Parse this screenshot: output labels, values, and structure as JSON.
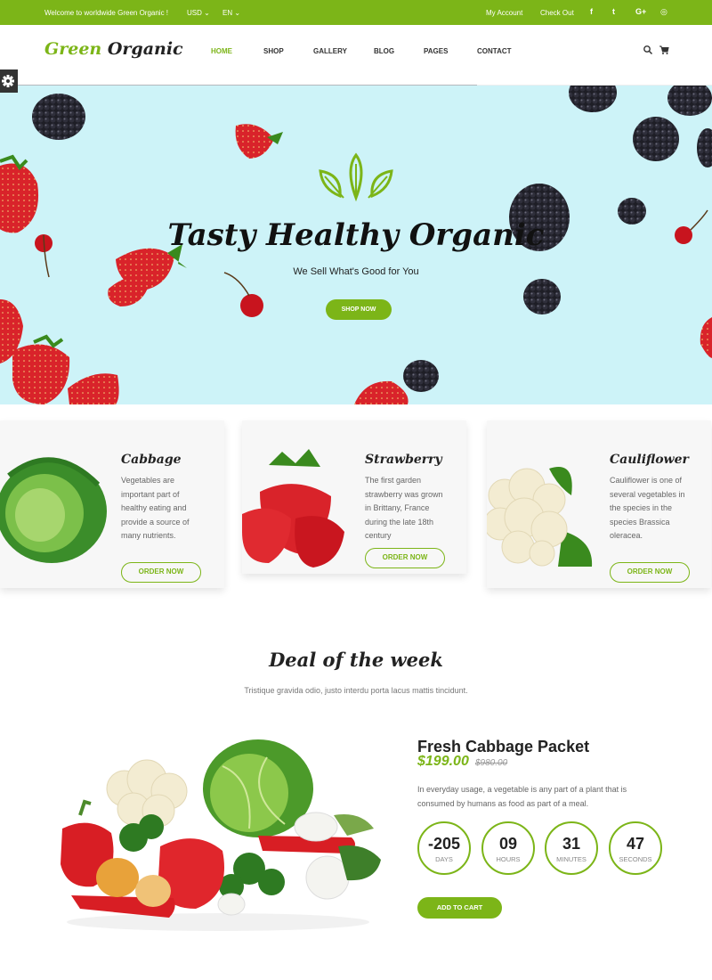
{
  "topbar": {
    "welcome": "Welcome to worldwide Green Organic !",
    "currency": "USD ⌄",
    "language": "EN ⌄",
    "my_account": "My Account",
    "check_out": "Check Out",
    "social": [
      {
        "icon": "facebook-icon",
        "glyph": "f"
      },
      {
        "icon": "twitter-icon",
        "glyph": "t"
      },
      {
        "icon": "google-plus-icon",
        "glyph": "G+"
      },
      {
        "icon": "instagram-icon",
        "glyph": "◎"
      }
    ]
  },
  "header": {
    "logo_green": "Green",
    "logo_dark": "Organic",
    "nav": [
      "HOME",
      "SHOP",
      "GALLERY",
      "BLOG",
      "PAGES",
      "CONTACT"
    ],
    "active_nav": "HOME",
    "icons": [
      "search-icon",
      "cart-icon"
    ],
    "page_load_progress": 0.67
  },
  "hero": {
    "title": "Tasty Healthy Organic",
    "subtitle": "We Sell What's Good for You",
    "button": "SHOP NOW"
  },
  "cards": [
    {
      "title": "Cabbage",
      "desc": "Vegetables are important part of healthy eating and provide a source of many nutrients.",
      "button": "ORDER NOW"
    },
    {
      "title": "Strawberry",
      "desc": "The first garden strawberry was grown in Brittany, France during the late 18th century",
      "button": "ORDER NOW"
    },
    {
      "title": "Cauliflower",
      "desc": "Cauliflower is one of several vegetables in the species in the species Brassica oleracea.",
      "button": "ORDER NOW"
    }
  ],
  "deal": {
    "title": "Deal of the week",
    "subtitle": "Tristique gravida odio, justo interdu porta lacus mattis tincidunt.",
    "product_name": "Fresh Cabbage Packet",
    "price": "$199.00",
    "old_price": "$980.00",
    "description": "In everyday usage, a vegetable is any part of a plant that is consumed by humans as food as part of a meal.",
    "countdown": [
      {
        "value": "-205",
        "label": "DAYS"
      },
      {
        "value": "09",
        "label": "HOURS"
      },
      {
        "value": "31",
        "label": "MINUTES"
      },
      {
        "value": "47",
        "label": "SECONDS"
      }
    ],
    "button": "ADD TO CART"
  },
  "colors": {
    "accent": "#7cb518",
    "hero_bg": "#cdf3f8",
    "card_bg": "#f7f7f7"
  }
}
